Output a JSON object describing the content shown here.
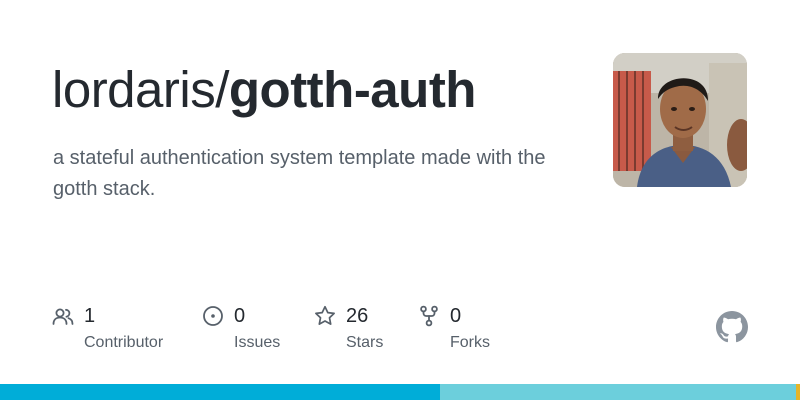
{
  "repo": {
    "owner": "lordaris/",
    "name": "gotth-auth",
    "description": "a stateful authentication system template made with the gotth stack."
  },
  "stats": {
    "contributors": {
      "value": "1",
      "label": "Contributor",
      "icon": "people-icon"
    },
    "issues": {
      "value": "0",
      "label": "Issues",
      "icon": "issue-opened-icon"
    },
    "stars": {
      "value": "26",
      "label": "Stars",
      "icon": "star-icon"
    },
    "forks": {
      "value": "0",
      "label": "Forks",
      "icon": "repo-forked-icon"
    }
  },
  "language_bar": [
    {
      "color": "#00add8",
      "fraction": 0.55
    },
    {
      "color": "#6ccfdc",
      "fraction": 0.445
    },
    {
      "color": "#e4b429",
      "fraction": 0.005
    }
  ],
  "colors": {
    "text_primary": "#24292f",
    "text_muted": "#57606a",
    "icon_muted": "#57606a",
    "github_mark": "#8c959f"
  }
}
